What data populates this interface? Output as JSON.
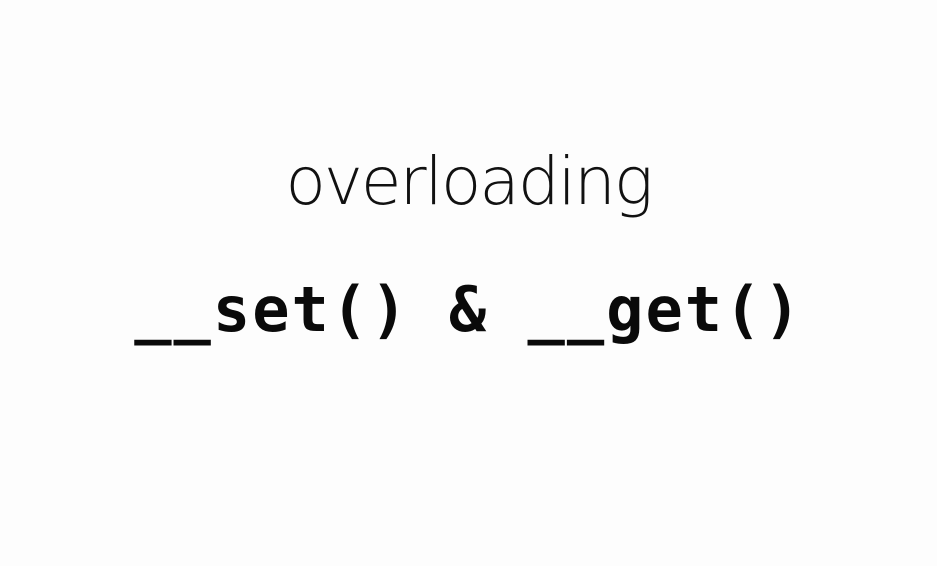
{
  "slide": {
    "title": "overloading",
    "subtitle": "__set() & __get()"
  }
}
